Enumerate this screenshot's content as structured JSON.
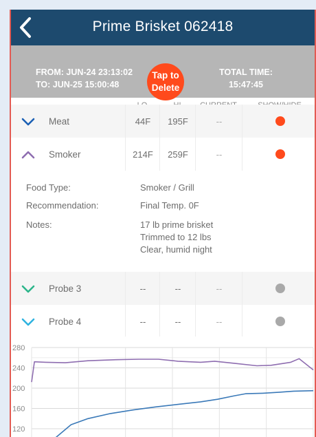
{
  "nav": {
    "title": "Prime Brisket 062418"
  },
  "session": {
    "from": "FROM: JUN-24 23:13:02",
    "to": "TO: JUN-25 15:00:48",
    "delete_line1": "Tap to",
    "delete_line2": "Delete",
    "total_label": "TOTAL TIME:",
    "total_value": "15:47:45"
  },
  "table": {
    "headers": {
      "lo": "LO",
      "hi": "HI",
      "current": "CURRENT",
      "show_hide": "SHOW/HIDE"
    },
    "rows": [
      {
        "name": "Meat",
        "lo": "44F",
        "hi": "195F",
        "current": "--",
        "visible": true,
        "chevron": "down",
        "color": "#1a5fb4",
        "dot": "#ff4a1c"
      },
      {
        "name": "Smoker",
        "lo": "214F",
        "hi": "259F",
        "current": "--",
        "visible": true,
        "chevron": "up",
        "color": "#8e6db0",
        "dot": "#ff4a1c"
      },
      {
        "name": "Probe 3",
        "lo": "--",
        "hi": "--",
        "current": "--",
        "visible": false,
        "chevron": "down",
        "color": "#2bb58a",
        "dot": "#a9a9a9"
      },
      {
        "name": "Probe 4",
        "lo": "--",
        "hi": "--",
        "current": "--",
        "visible": false,
        "chevron": "down",
        "color": "#2fb3e0",
        "dot": "#a9a9a9"
      }
    ]
  },
  "details": {
    "food_type_label": "Food Type:",
    "food_type": "Smoker / Grill",
    "recommendation_label": "Recommendation:",
    "recommendation": "Final Temp. 0F",
    "notes_label": "Notes:",
    "notes": [
      "17 lb prime brisket",
      "Trimmed to 12 lbs",
      "Clear, humid night"
    ]
  },
  "chart_data": {
    "type": "line",
    "y_ticks": [
      "280",
      "240",
      "200",
      "160",
      "120"
    ],
    "ylim": [
      100,
      280
    ],
    "grid": true,
    "series": [
      {
        "color": "#8e6db0",
        "values": [
          [
            0,
            212
          ],
          [
            1,
            252
          ],
          [
            5,
            251
          ],
          [
            12,
            250
          ],
          [
            20,
            254
          ],
          [
            30,
            256
          ],
          [
            38,
            257
          ],
          [
            45,
            257
          ],
          [
            52,
            253
          ],
          [
            60,
            251
          ],
          [
            65,
            253
          ],
          [
            72,
            249
          ],
          [
            80,
            244
          ],
          [
            85,
            245
          ],
          [
            92,
            251
          ],
          [
            95,
            258
          ],
          [
            100,
            236
          ]
        ]
      },
      {
        "color": "#3a79b8",
        "values": [
          [
            8,
            100
          ],
          [
            14,
            128
          ],
          [
            20,
            140
          ],
          [
            28,
            150
          ],
          [
            36,
            157
          ],
          [
            44,
            163
          ],
          [
            52,
            168
          ],
          [
            60,
            173
          ],
          [
            66,
            178
          ],
          [
            72,
            185
          ],
          [
            76,
            189
          ],
          [
            82,
            190
          ],
          [
            88,
            192
          ],
          [
            93,
            194
          ],
          [
            100,
            195
          ]
        ]
      }
    ]
  },
  "colors": {
    "nav": "#1d4a6e",
    "accent": "#ff4a1c",
    "banner": "#b6b6b6"
  },
  "icons": {
    "back": "back-chevron-icon"
  }
}
